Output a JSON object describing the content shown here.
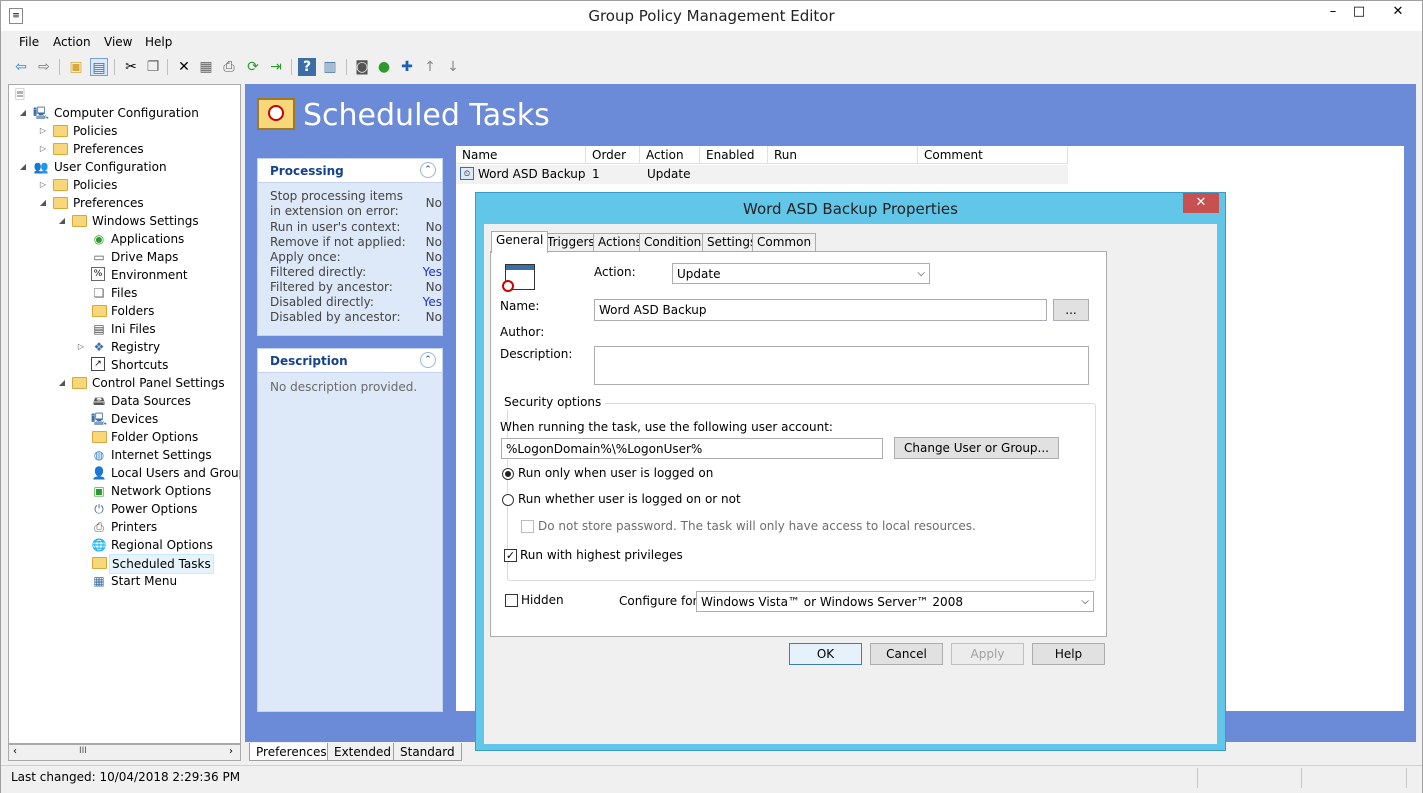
{
  "window": {
    "title": "Group Policy Management Editor",
    "minimize": "–",
    "maximize": "□",
    "close": "✕"
  },
  "menu": [
    "File",
    "Action",
    "View",
    "Help"
  ],
  "toolbar": {
    "icons": [
      "back-icon",
      "forward-icon",
      "up-folder-icon",
      "show-hide-tree-icon",
      "cut-icon",
      "copy-icon",
      "delete-icon",
      "properties-icon",
      "print-icon",
      "refresh-icon",
      "export-icon",
      "help-icon",
      "view-icon",
      "new-icon",
      "run-icon",
      "add-icon",
      "move-up-icon",
      "move-down-icon"
    ]
  },
  "tree": {
    "root_icon": "document-icon",
    "nodes": [
      {
        "label": "Computer Configuration"
      },
      {
        "label": "Policies"
      },
      {
        "label": "Preferences"
      },
      {
        "label": "User Configuration"
      },
      {
        "label": "Policies"
      },
      {
        "label": "Preferences"
      },
      {
        "label": "Windows Settings"
      },
      {
        "label": "Applications"
      },
      {
        "label": "Drive Maps"
      },
      {
        "label": "Environment"
      },
      {
        "label": "Files"
      },
      {
        "label": "Folders"
      },
      {
        "label": "Ini Files"
      },
      {
        "label": "Registry"
      },
      {
        "label": "Shortcuts"
      },
      {
        "label": "Control Panel Settings"
      },
      {
        "label": "Data Sources"
      },
      {
        "label": "Devices"
      },
      {
        "label": "Folder Options"
      },
      {
        "label": "Internet Settings"
      },
      {
        "label": "Local Users and Groups"
      },
      {
        "label": "Network Options"
      },
      {
        "label": "Power Options"
      },
      {
        "label": "Printers"
      },
      {
        "label": "Regional Options"
      },
      {
        "label": "Scheduled Tasks"
      },
      {
        "label": "Start Menu"
      }
    ],
    "scroll_thumb": "III"
  },
  "content": {
    "heading": "Scheduled Tasks",
    "processing": {
      "title": "Processing",
      "rows": [
        {
          "label": "Stop processing items in extension on error:",
          "value": "No"
        },
        {
          "label": "Run in user's context:",
          "value": "No"
        },
        {
          "label": "Remove if not applied:",
          "value": "No"
        },
        {
          "label": "Apply once:",
          "value": "No"
        },
        {
          "label": "Filtered directly:",
          "value": "Yes"
        },
        {
          "label": "Filtered by ancestor:",
          "value": "No"
        },
        {
          "label": "Disabled directly:",
          "value": "Yes"
        },
        {
          "label": "Disabled by ancestor:",
          "value": "No"
        }
      ]
    },
    "description": {
      "title": "Description",
      "text": "No description provided."
    },
    "columns": [
      "Name",
      "Order",
      "Action",
      "Enabled",
      "Run",
      "Comment"
    ],
    "rows": [
      {
        "name": "Word ASD Backup",
        "order": "1",
        "action": "Update",
        "enabled": "",
        "run": "",
        "comment": ""
      }
    ],
    "bottom_tabs": [
      "Preferences",
      "Extended",
      "Standard"
    ]
  },
  "status": {
    "text": "Last changed: 10/04/2018 2:29:36 PM"
  },
  "dialog": {
    "title": "Word ASD Backup Properties",
    "close": "✕",
    "tabs": [
      "General",
      "Triggers",
      "Actions",
      "Conditions",
      "Settings",
      "Common"
    ],
    "action_label": "Action:",
    "action_value": "Update",
    "name_label": "Name:",
    "name_value": "Word ASD Backup",
    "browse_label": "...",
    "author_label": "Author:",
    "description_label": "Description:",
    "description_value": "",
    "security_legend": "Security options",
    "account_prompt": "When running the task, use the following user account:",
    "account_value": "%LogonDomain%\\%LogonUser%",
    "change_user_label": "Change User or Group...",
    "radio_logged_on": "Run only when user is logged on",
    "radio_whether": "Run whether user is logged on or not",
    "no_store_password": "Do not store password. The task will only have access to local resources.",
    "highest_privileges": "Run with highest privileges",
    "hidden_label": "Hidden",
    "configure_label": "Configure for:",
    "configure_value": "Windows Vista™ or Windows Server™ 2008",
    "ok": "OK",
    "cancel": "Cancel",
    "apply": "Apply",
    "help": "Help"
  }
}
